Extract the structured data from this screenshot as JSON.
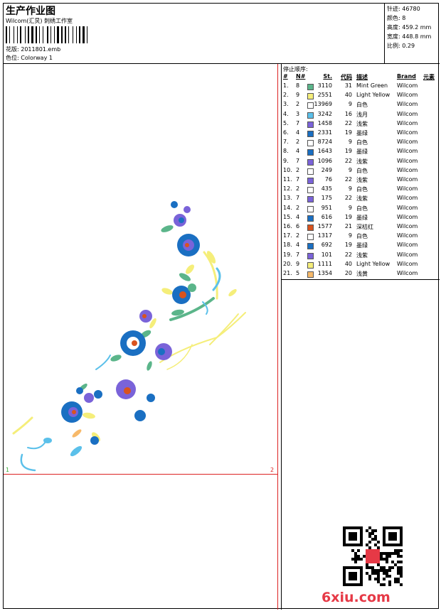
{
  "header": {
    "title": "生产作业图",
    "studio": "Wilcom(汇炅) 刺绣工作室",
    "file_label": "花版:",
    "file_name": "2011801.emb",
    "colorway_label": "色位:",
    "colorway_name": "Colorway 1"
  },
  "stats": [
    {
      "label": "针迹:",
      "value": "46780"
    },
    {
      "label": "颜色:",
      "value": "8"
    },
    {
      "label": "高度:",
      "value": "459.2 mm"
    },
    {
      "label": "宽度:",
      "value": "448.8 mm"
    },
    {
      "label": "比例:",
      "value": "0.29"
    }
  ],
  "sequence": {
    "title": "停止顺序:",
    "headers": {
      "idx": "#",
      "n": "N#",
      "st": "St.",
      "code": "代码",
      "desc": "描述",
      "brand": "Brand",
      "elem": "元素"
    },
    "rows": [
      {
        "idx": "1.",
        "n": "8",
        "color": "#5bb58a",
        "st": "3110",
        "code": "31",
        "desc": "Mint Green",
        "brand": "Wilcom"
      },
      {
        "idx": "2.",
        "n": "9",
        "color": "#f5ee7a",
        "st": "2551",
        "code": "40",
        "desc": "Light Yellow",
        "brand": "Wilcom"
      },
      {
        "idx": "3.",
        "n": "2",
        "color": "#ffffff",
        "st": "13969",
        "code": "9",
        "desc": "白色",
        "brand": "Wilcom"
      },
      {
        "idx": "4.",
        "n": "3",
        "color": "#5bc0ea",
        "st": "3242",
        "code": "16",
        "desc": "浅月",
        "brand": "Wilcom"
      },
      {
        "idx": "5.",
        "n": "7",
        "color": "#7a63d9",
        "st": "1458",
        "code": "22",
        "desc": "浅紫",
        "brand": "Wilcom"
      },
      {
        "idx": "6.",
        "n": "4",
        "color": "#1a6fc2",
        "st": "2331",
        "code": "19",
        "desc": "墨绿",
        "brand": "Wilcom"
      },
      {
        "idx": "7.",
        "n": "2",
        "color": "#ffffff",
        "st": "8724",
        "code": "9",
        "desc": "白色",
        "brand": "Wilcom"
      },
      {
        "idx": "8.",
        "n": "4",
        "color": "#1a6fc2",
        "st": "1643",
        "code": "19",
        "desc": "墨绿",
        "brand": "Wilcom"
      },
      {
        "idx": "9.",
        "n": "7",
        "color": "#7a63d9",
        "st": "1096",
        "code": "22",
        "desc": "浅紫",
        "brand": "Wilcom"
      },
      {
        "idx": "10.",
        "n": "2",
        "color": "#ffffff",
        "st": "249",
        "code": "9",
        "desc": "白色",
        "brand": "Wilcom"
      },
      {
        "idx": "11.",
        "n": "7",
        "color": "#7a63d9",
        "st": "76",
        "code": "22",
        "desc": "浅紫",
        "brand": "Wilcom"
      },
      {
        "idx": "12.",
        "n": "2",
        "color": "#ffffff",
        "st": "435",
        "code": "9",
        "desc": "白色",
        "brand": "Wilcom"
      },
      {
        "idx": "13.",
        "n": "7",
        "color": "#7a63d9",
        "st": "175",
        "code": "22",
        "desc": "浅紫",
        "brand": "Wilcom"
      },
      {
        "idx": "14.",
        "n": "2",
        "color": "#ffffff",
        "st": "951",
        "code": "9",
        "desc": "白色",
        "brand": "Wilcom"
      },
      {
        "idx": "15.",
        "n": "4",
        "color": "#1a6fc2",
        "st": "616",
        "code": "19",
        "desc": "墨绿",
        "brand": "Wilcom"
      },
      {
        "idx": "16.",
        "n": "6",
        "color": "#d9531e",
        "st": "1577",
        "code": "21",
        "desc": "深桔红",
        "brand": "Wilcom"
      },
      {
        "idx": "17.",
        "n": "2",
        "color": "#ffffff",
        "st": "1317",
        "code": "9",
        "desc": "白色",
        "brand": "Wilcom"
      },
      {
        "idx": "18.",
        "n": "4",
        "color": "#1a6fc2",
        "st": "692",
        "code": "19",
        "desc": "墨绿",
        "brand": "Wilcom"
      },
      {
        "idx": "19.",
        "n": "7",
        "color": "#7a63d9",
        "st": "101",
        "code": "22",
        "desc": "浅紫",
        "brand": "Wilcom"
      },
      {
        "idx": "20.",
        "n": "9",
        "color": "#f5ee7a",
        "st": "1111",
        "code": "40",
        "desc": "Light Yellow",
        "brand": "Wilcom"
      },
      {
        "idx": "21.",
        "n": "5",
        "color": "#f7b96a",
        "st": "1354",
        "code": "20",
        "desc": "浅黄",
        "brand": "Wilcom"
      }
    ]
  },
  "hoop_marks": {
    "left": "1",
    "right": "2"
  },
  "watermark": "6xiu.com"
}
